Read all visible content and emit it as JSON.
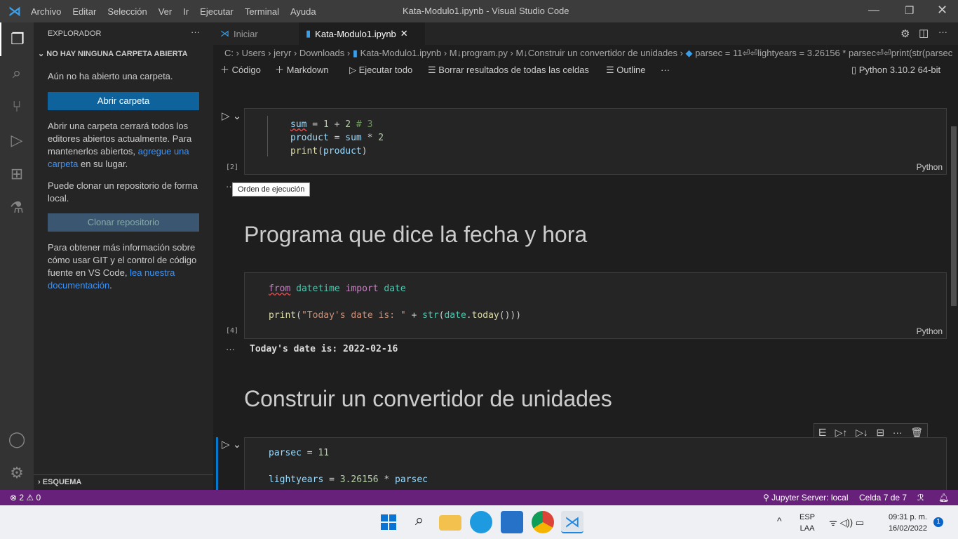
{
  "titlebar": {
    "menu": [
      "Archivo",
      "Editar",
      "Selección",
      "Ver",
      "Ir",
      "Ejecutar",
      "Terminal",
      "Ayuda"
    ],
    "title": "Kata-Modulo1.ipynb - Visual Studio Code"
  },
  "sidebar": {
    "header": "EXPLORADOR",
    "section": "NO HAY NINGUNA CARPETA ABIERTA",
    "no_folder": "Aún no ha abierto una carpeta.",
    "open_folder": "Abrir carpeta",
    "warning_pre": "Abrir una carpeta cerrará todos los editores abiertos actualmente. Para mantenerlos abiertos, ",
    "warning_link": "agregue una carpeta",
    "warning_post": " en su lugar.",
    "clone_text": "Puede clonar un repositorio de forma local.",
    "clone_button": "Clonar repositorio",
    "git_pre": "Para obtener más información sobre cómo usar GIT y el control de código fuente en VS Code, ",
    "git_link": "lea nuestra documentación",
    "git_post": ".",
    "outline": "ESQUEMA"
  },
  "tabs": [
    {
      "label": "Iniciar"
    },
    {
      "label": "Kata-Modulo1.ipynb",
      "active": true
    }
  ],
  "breadcrumb": [
    "C:",
    "Users",
    "jeryr",
    "Downloads",
    "Kata-Modulo1.ipynb",
    "M↓program.py",
    "M↓Construir un convertidor de unidades",
    "parsec = 11⏎⏎lightyears = 3.26156 * parsec⏎⏎print(str(parsec"
  ],
  "toolbar": {
    "code": "Código",
    "markdown": "Markdown",
    "run_all": "Ejecutar todo",
    "clear": "Borrar resultados de todas las celdas",
    "outline": "Outline",
    "kernel": "Python 3.10.2 64-bit"
  },
  "cells": {
    "c1": {
      "count": "[2]",
      "lang": "Python",
      "lines": [
        [
          "sum",
          " = ",
          "1",
          " + ",
          "2",
          " # 3"
        ],
        [
          "product",
          " = ",
          "sum",
          " * ",
          "2"
        ],
        [
          "print",
          "(",
          "product",
          ")"
        ]
      ]
    },
    "tooltip": "Orden de ejecución",
    "h1": "Programa que dice la fecha y hora",
    "c2": {
      "count": "[4]",
      "lang": "Python",
      "l1": [
        "from",
        " ",
        "datetime",
        " ",
        "import",
        " ",
        "date"
      ],
      "l2": [
        "print",
        "(",
        "\"Today's date is: \"",
        " + ",
        "str",
        "(",
        "date",
        ".",
        "today",
        "()))"
      ]
    },
    "output2": "Today's date is: 2022-02-16",
    "h2": "Construir un convertidor de unidades",
    "c3": {
      "l1": [
        "parsec",
        " = ",
        "11"
      ],
      "l2": [
        "lightyears",
        " = ",
        "3.26156",
        " * ",
        "parsec"
      ]
    }
  },
  "status": {
    "errors": "2",
    "warnings": "0",
    "jupyter": "Jupyter Server: local",
    "cell": "Celda 7 de 7"
  },
  "taskbar": {
    "lang1": "ESP",
    "lang2": "LAA",
    "time": "09:31 p. m.",
    "date": "16/02/2022",
    "notif": "1"
  },
  "colors": {
    "statusbar": "#68217a",
    "accent": "#0e639c"
  }
}
